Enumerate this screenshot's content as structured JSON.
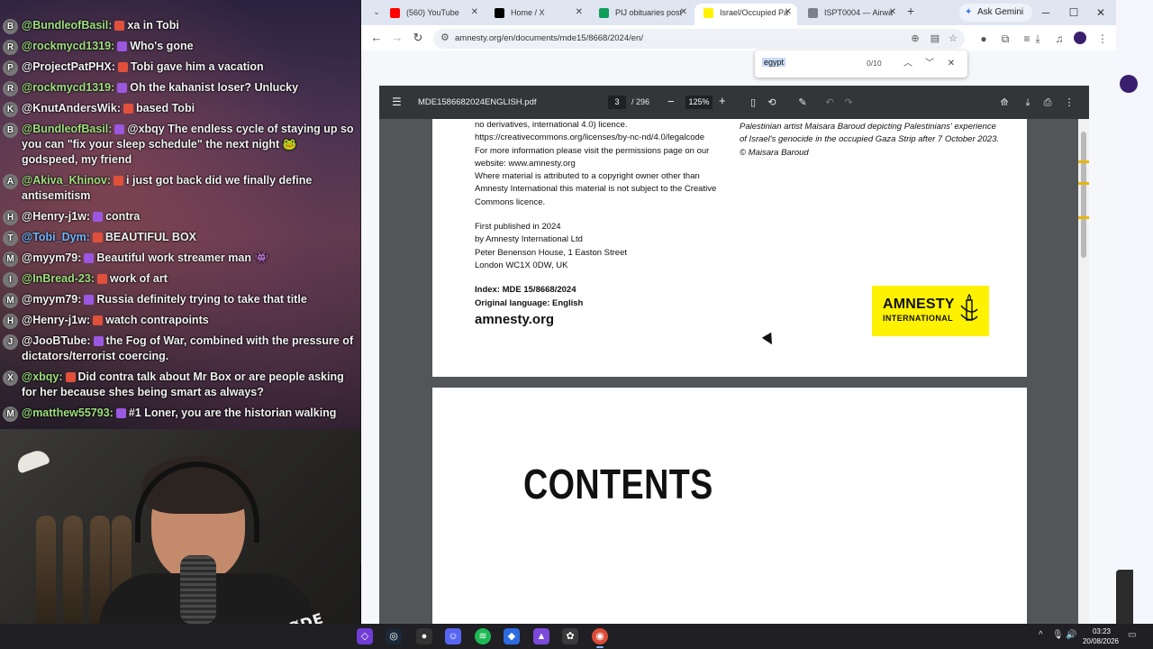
{
  "chat": {
    "messages": [
      {
        "user": "@BundleofBasil:",
        "text": "xa in Tobi",
        "avatar": "B",
        "color": "green"
      },
      {
        "user": "@rockmycd1319:",
        "text": "Who's gone",
        "avatar": "R",
        "color": "green"
      },
      {
        "user": "@ProjectPatPHX:",
        "text": "Tobi gave him a vacation",
        "avatar": "P",
        "color": "white"
      },
      {
        "user": "@rockmycd1319:",
        "text": "Oh the kahanist loser? Unlucky",
        "avatar": "R",
        "color": "green"
      },
      {
        "user": "@KnutAndersWik:",
        "text": "based Tobi",
        "avatar": "K",
        "color": "white"
      },
      {
        "user": "@BundleofBasil:",
        "text": "@xbqy The endless cycle of staying up so you can \"fix your sleep schedule\" the next night 🐸 godspeed, my friend",
        "avatar": "B",
        "color": "green"
      },
      {
        "user": "@Akiva_Khinov:",
        "text": "i just got back did we finally define antisemitism",
        "avatar": "A",
        "color": "green"
      },
      {
        "user": "@Henry-j1w:",
        "text": "contra",
        "avatar": "H",
        "color": "white"
      },
      {
        "user": "@Tobi_Dym:",
        "text": "BEAUTIFUL BOX",
        "avatar": "T",
        "color": "blue"
      },
      {
        "user": "@myym79:",
        "text": "Beautiful work streamer man 👾",
        "avatar": "M",
        "color": "white"
      },
      {
        "user": "@InBread-23:",
        "text": "work of art",
        "avatar": "I",
        "color": "green"
      },
      {
        "user": "@myym79:",
        "text": "Russia definitely trying to take that title",
        "avatar": "M",
        "color": "white"
      },
      {
        "user": "@Henry-j1w:",
        "text": "watch contrapoints",
        "avatar": "H",
        "color": "white"
      },
      {
        "user": "@JooBTube:",
        "text": "the Fog of War, combined with the pressure of dictators/terrorist coercing.",
        "avatar": "J",
        "color": "white"
      },
      {
        "user": "@xbqy:",
        "text": "Did contra talk about Mr Box or are people asking for her because shes being smart as always?",
        "avatar": "X",
        "color": "green"
      },
      {
        "user": "@matthew55793:",
        "text": "#1 Loner, you are the historian walking",
        "avatar": "M",
        "color": "green"
      }
    ]
  },
  "webcam": {
    "mic_brand": "RØDE"
  },
  "browser": {
    "tabs": [
      {
        "title": "(560) YouTube",
        "color": "#ff0000"
      },
      {
        "title": "Home / X",
        "color": "#000000"
      },
      {
        "title": "PIJ obituaries post",
        "color": "#0f9d58"
      },
      {
        "title": "Israel/Occupied Pa",
        "color": "#fff200",
        "active": true
      },
      {
        "title": "ISPT0004 — Airwa",
        "color": "#7a7f8c"
      }
    ],
    "ask_gemini": "Ask Gemini",
    "url": "amnesty.org/en/documents/mde15/8668/2024/en/",
    "find": {
      "query": "egypt",
      "count": "0/10"
    }
  },
  "pdf": {
    "filename": "MDE1586682024ENGLISH.pdf",
    "current_page": "3",
    "total_pages": "/ 296",
    "zoom": "125%",
    "page1": {
      "licence_lines": "no derivatives, international 4.0) licence.",
      "licence_url": "https://creativecommons.org/licenses/by-nc-nd/4.0/legalcode",
      "permissions": "For more information please visit the permissions page on our website: www.amnesty.org",
      "attribution": "Where material is attributed to a copyright owner other than Amnesty International this material is not subject to the Creative Commons licence.",
      "published": [
        "First published in 2024",
        "by Amnesty International Ltd",
        "Peter Benenson House, 1 Easton Street",
        "London WC1X 0DW, UK"
      ],
      "index": "Index: MDE 15/8668/2024",
      "language": "Original language: English",
      "site": "amnesty.org",
      "caption_lines": [
        "Palestinian artist Maisara Baroud depicting Palestinians' experience",
        "of Israel's genocide in the occupied Gaza Strip after 7 October 2023.",
        "© Maisara Baroud"
      ],
      "logo_line1": "AMNESTY",
      "logo_line2": "INTERNATIONAL"
    },
    "page2": {
      "heading": "CONTENTS"
    }
  },
  "taskbar": {
    "time": "03:23",
    "date": "20/08/2026"
  }
}
